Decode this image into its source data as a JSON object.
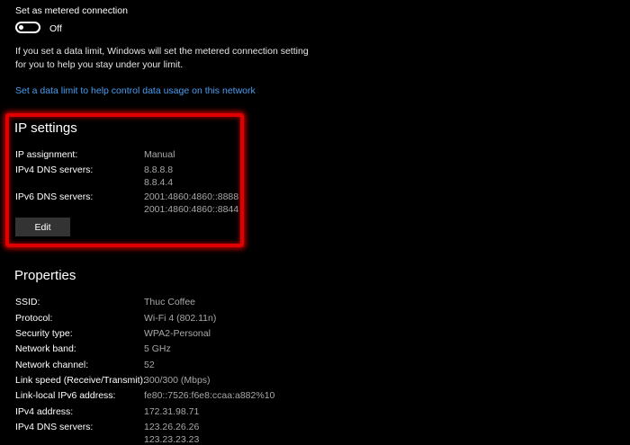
{
  "metered": {
    "title": "Set as metered connection",
    "toggle_state": "Off",
    "toggle_on": false,
    "description": "If you set a data limit, Windows will set the metered connection setting for you to help you stay under your limit.",
    "link": "Set a data limit to help control data usage on this network"
  },
  "ip_settings": {
    "heading": "IP settings",
    "highlight_color": "#e00000",
    "rows": [
      {
        "label": "IP assignment:",
        "values": [
          "Manual"
        ]
      },
      {
        "label": "IPv4 DNS servers:",
        "values": [
          "8.8.8.8",
          "8.8.4.4"
        ]
      },
      {
        "label": "IPv6 DNS servers:",
        "values": [
          "2001:4860:4860::8888",
          "2001:4860:4860::8844"
        ]
      }
    ],
    "edit_button": "Edit"
  },
  "properties": {
    "heading": "Properties",
    "rows": [
      {
        "label": "SSID:",
        "value": "Thuc Coffee"
      },
      {
        "label": "Protocol:",
        "value": "Wi-Fi 4 (802.11n)"
      },
      {
        "label": "Security type:",
        "value": "WPA2-Personal"
      },
      {
        "label": "Network band:",
        "value": "5 GHz"
      },
      {
        "label": "Network channel:",
        "value": "52"
      },
      {
        "label": "Link speed (Receive/Transmit):",
        "value": "300/300 (Mbps)"
      },
      {
        "label": "Link-local IPv6 address:",
        "value": "fe80::7526:f6e8:ccaa:a882%10"
      },
      {
        "label": "IPv4 address:",
        "value": "172.31.98.71"
      },
      {
        "label": "IPv4 DNS servers:",
        "values": [
          "123.26.26.26",
          "123.23.23.23"
        ]
      }
    ]
  }
}
